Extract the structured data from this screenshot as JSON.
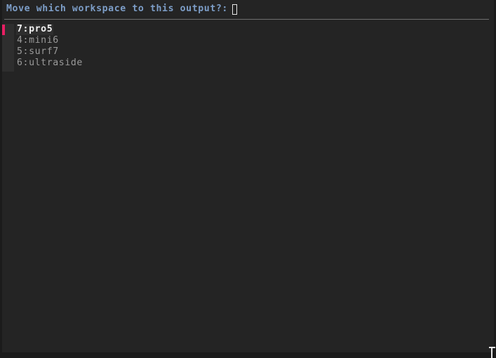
{
  "window": {
    "background_color": "#242424",
    "border_color": "#1b1b1b"
  },
  "prompt": {
    "label": "Move which workspace to this output?:",
    "color": "#7d9ec8",
    "input_value": "",
    "cursor_glyph": "text-cursor-box"
  },
  "separator": {
    "color": "#6e6e6e"
  },
  "list": {
    "selected_index": 0,
    "selected_marker_color": "#e91e63",
    "selected_text_color": "#f2f2f2",
    "item_text_color": "#9a9a9a",
    "items": [
      {
        "label": "7:pro5",
        "number": "7",
        "name": "pro5",
        "selected": true
      },
      {
        "label": "4:mini6",
        "number": "4",
        "name": "mini6",
        "selected": false
      },
      {
        "label": "5:surf7",
        "number": "5",
        "name": "surf7",
        "selected": false
      },
      {
        "label": "6:ultraside",
        "number": "6",
        "name": "ultraside",
        "selected": false
      }
    ]
  },
  "pointer": {
    "shape": "i-beam-cursor"
  }
}
